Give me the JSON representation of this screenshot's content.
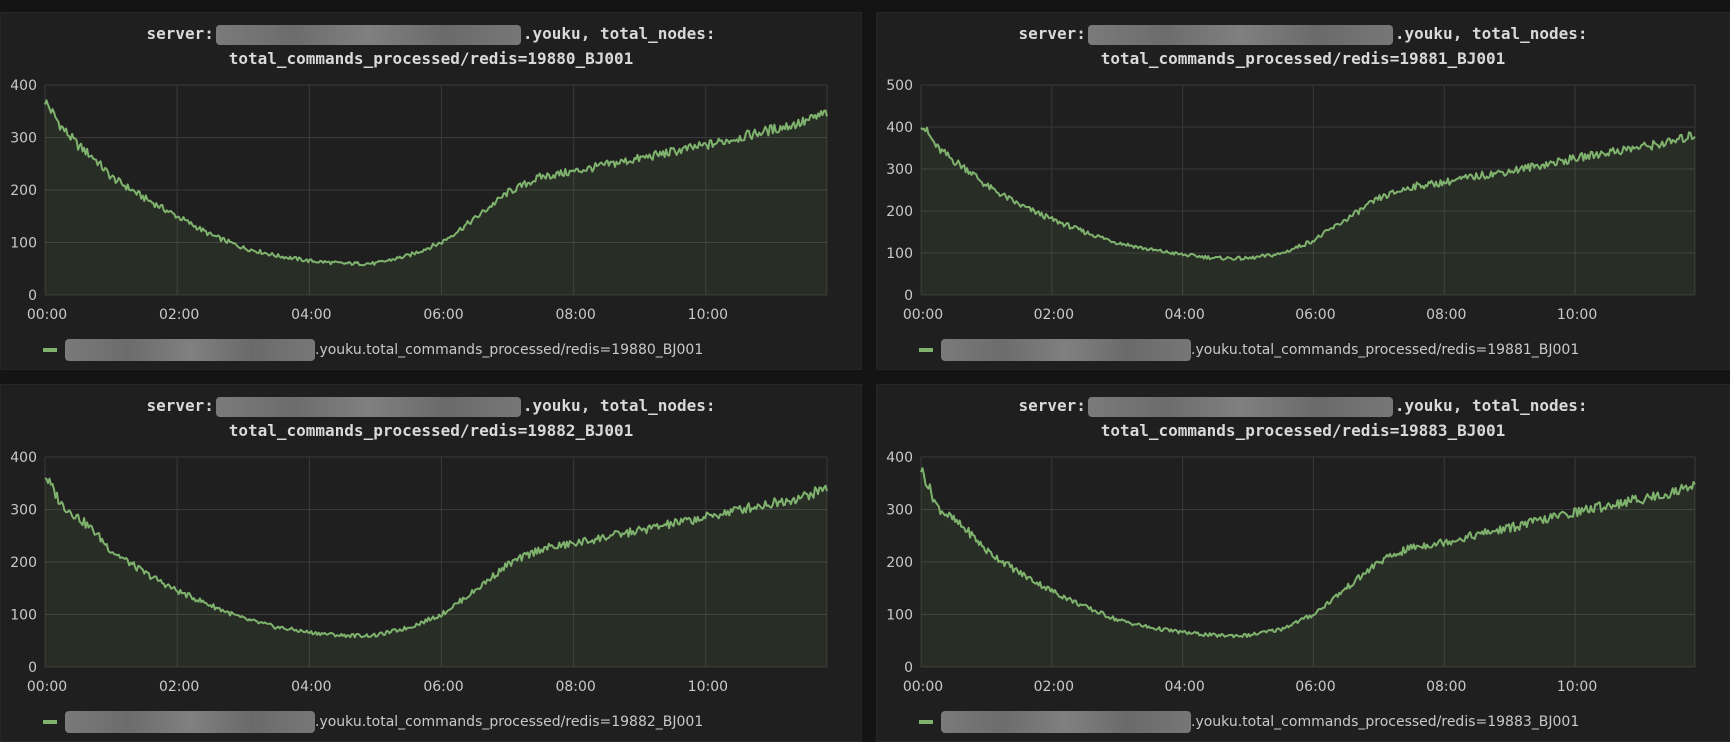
{
  "panels": [
    {
      "title_line1_prefix": "server:",
      "title_line1_suffix": ".youku, total_nodes:",
      "title_line2": "total_commands_processed/redis=19880_BJ001",
      "legend_suffix": ".youku.total_commands_processed/redis=19880_BJ001"
    },
    {
      "title_line1_prefix": "server:",
      "title_line1_suffix": ".youku, total_nodes:",
      "title_line2": "total_commands_processed/redis=19881_BJ001",
      "legend_suffix": ".youku.total_commands_processed/redis=19881_BJ001"
    },
    {
      "title_line1_prefix": "server:",
      "title_line1_suffix": ".youku, total_nodes:",
      "title_line2": "total_commands_processed/redis=19882_BJ001",
      "legend_suffix": ".youku.total_commands_processed/redis=19882_BJ001"
    },
    {
      "title_line1_prefix": "server:",
      "title_line1_suffix": ".youku, total_nodes:",
      "title_line2": "total_commands_processed/redis=19883_BJ001",
      "legend_suffix": ".youku.total_commands_processed/redis=19883_BJ001"
    }
  ],
  "chart_data": [
    {
      "type": "area",
      "title": "server: [redacted].youku, total_nodes: total_commands_processed/redis=19880_BJ001",
      "xlabel": "",
      "ylabel": "",
      "x_ticks": [
        "00:00",
        "02:00",
        "04:00",
        "06:00",
        "08:00",
        "10:00"
      ],
      "ylim": [
        0,
        400
      ],
      "y_ticks": [
        0,
        100,
        200,
        300,
        400
      ],
      "grid": true,
      "legend": "bottom-left",
      "series_color": "#7eb26d",
      "series": [
        {
          "x": [
            "00:00",
            "00:15",
            "00:30",
            "00:45",
            "01:00",
            "01:30",
            "02:00",
            "02:30",
            "03:00",
            "03:30",
            "04:00",
            "04:30",
            "05:00",
            "05:30",
            "06:00",
            "06:30",
            "07:00",
            "07:30",
            "08:00",
            "08:30",
            "09:00",
            "09:30",
            "10:00",
            "10:30",
            "11:00",
            "11:30",
            "11:50"
          ],
          "values": [
            370,
            320,
            285,
            260,
            225,
            185,
            150,
            115,
            90,
            75,
            65,
            60,
            60,
            75,
            100,
            145,
            195,
            225,
            235,
            248,
            260,
            273,
            285,
            300,
            315,
            330,
            347
          ]
        }
      ]
    },
    {
      "type": "area",
      "title": "server: [redacted].youku, total_nodes: total_commands_processed/redis=19881_BJ001",
      "xlabel": "",
      "ylabel": "",
      "x_ticks": [
        "00:00",
        "02:00",
        "04:00",
        "06:00",
        "08:00",
        "10:00"
      ],
      "ylim": [
        0,
        500
      ],
      "y_ticks": [
        0,
        100,
        200,
        300,
        400,
        500
      ],
      "grid": true,
      "legend": "bottom-left",
      "series_color": "#7eb26d",
      "series": [
        {
          "x": [
            "00:00",
            "00:15",
            "00:30",
            "00:45",
            "01:00",
            "01:30",
            "02:00",
            "02:30",
            "03:00",
            "03:30",
            "04:00",
            "04:30",
            "05:00",
            "05:30",
            "06:00",
            "06:30",
            "07:00",
            "07:30",
            "08:00",
            "08:30",
            "09:00",
            "09:30",
            "10:00",
            "10:30",
            "11:00",
            "11:30",
            "11:50"
          ],
          "values": [
            410,
            350,
            320,
            295,
            260,
            215,
            180,
            150,
            125,
            108,
            96,
            88,
            87,
            98,
            130,
            180,
            230,
            258,
            268,
            283,
            295,
            310,
            325,
            340,
            352,
            365,
            382
          ]
        }
      ]
    },
    {
      "type": "area",
      "title": "server: [redacted].youku, total_nodes: total_commands_processed/redis=19882_BJ001",
      "xlabel": "",
      "ylabel": "",
      "x_ticks": [
        "00:00",
        "02:00",
        "04:00",
        "06:00",
        "08:00",
        "10:00"
      ],
      "ylim": [
        0,
        400
      ],
      "y_ticks": [
        0,
        100,
        200,
        300,
        400
      ],
      "grid": true,
      "legend": "bottom-left",
      "series_color": "#7eb26d",
      "series": [
        {
          "x": [
            "00:00",
            "00:15",
            "00:30",
            "00:45",
            "01:00",
            "01:30",
            "02:00",
            "02:30",
            "03:00",
            "03:30",
            "04:00",
            "04:30",
            "05:00",
            "05:30",
            "06:00",
            "06:30",
            "07:00",
            "07:30",
            "08:00",
            "08:30",
            "09:00",
            "09:30",
            "10:00",
            "10:30",
            "11:00",
            "11:30",
            "11:50"
          ],
          "values": [
            365,
            310,
            285,
            258,
            222,
            180,
            145,
            118,
            92,
            76,
            66,
            60,
            60,
            75,
            100,
            145,
            195,
            225,
            235,
            248,
            260,
            273,
            285,
            300,
            312,
            325,
            342
          ]
        }
      ]
    },
    {
      "type": "area",
      "title": "server: [redacted].youku, total_nodes: total_commands_processed/redis=19883_BJ001",
      "xlabel": "",
      "ylabel": "",
      "x_ticks": [
        "00:00",
        "02:00",
        "04:00",
        "06:00",
        "08:00",
        "10:00"
      ],
      "ylim": [
        0,
        400
      ],
      "y_ticks": [
        0,
        100,
        200,
        300,
        400
      ],
      "grid": true,
      "legend": "bottom-left",
      "series_color": "#7eb26d",
      "series": [
        {
          "x": [
            "00:00",
            "00:15",
            "00:30",
            "00:45",
            "01:00",
            "01:30",
            "02:00",
            "02:30",
            "03:00",
            "03:30",
            "04:00",
            "04:30",
            "05:00",
            "05:30",
            "06:00",
            "06:30",
            "07:00",
            "07:30",
            "08:00",
            "08:30",
            "09:00",
            "09:30",
            "10:00",
            "10:30",
            "11:00",
            "11:30",
            "11:50"
          ],
          "values": [
            378,
            305,
            280,
            255,
            222,
            180,
            145,
            115,
            90,
            75,
            66,
            60,
            60,
            72,
            100,
            150,
            200,
            228,
            238,
            252,
            265,
            280,
            295,
            308,
            320,
            332,
            350
          ]
        }
      ]
    }
  ]
}
